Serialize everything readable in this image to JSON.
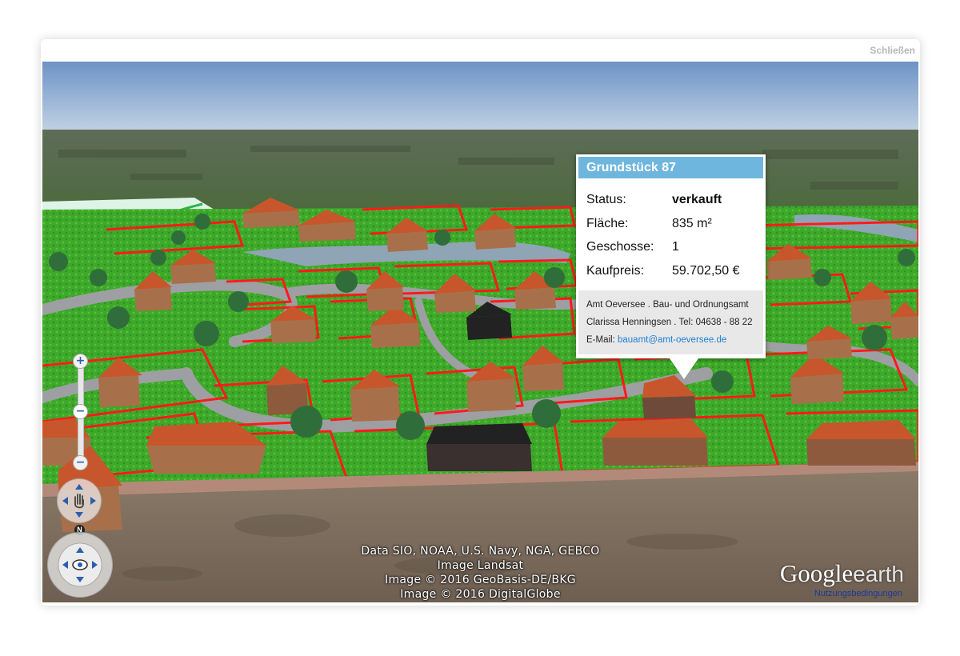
{
  "window": {
    "close_label": "Schließen"
  },
  "popup": {
    "title": "Grundstück 87",
    "rows": [
      {
        "label": "Status:",
        "value": "verkauft",
        "bold": true
      },
      {
        "label": "Fläche:",
        "value": "835 m²"
      },
      {
        "label": "Geschosse:",
        "value": "1"
      },
      {
        "label": "Kaufpreis:",
        "value": "59.702,50 €"
      }
    ],
    "contact": {
      "office": "Amt Oeversee . Bau- und Ordnungsamt",
      "person": "Clarissa Henningsen . Tel: 04638 - 88 22",
      "email_label": "E-Mail:",
      "email": "bauamt@amt-oeversee.de"
    }
  },
  "map": {
    "credits": [
      "Data SIO, NOAA, U.S. Navy, NGA, GEBCO",
      "Image Landsat",
      "Image © 2016 GeoBasis-DE/BKG",
      "Image © 2016 DigitalGlobe"
    ],
    "logo_google": "Google",
    "logo_earth": "earth",
    "terms": "Nutzungsbedingungen",
    "north_label": "N",
    "zoom_in": "+",
    "zoom_out": "−",
    "zoom_thumb": "−"
  },
  "icons": {
    "pan": "hand-pan-icon",
    "look": "eye-look-icon",
    "zoom_in": "zoom-in-icon",
    "zoom_out": "zoom-out-icon",
    "north": "compass-north-icon"
  },
  "colors": {
    "popup_header": "#6fb6de",
    "parcel_border": "#ff1a1a",
    "roof": "#c8562c",
    "link": "#1e7fd0"
  }
}
